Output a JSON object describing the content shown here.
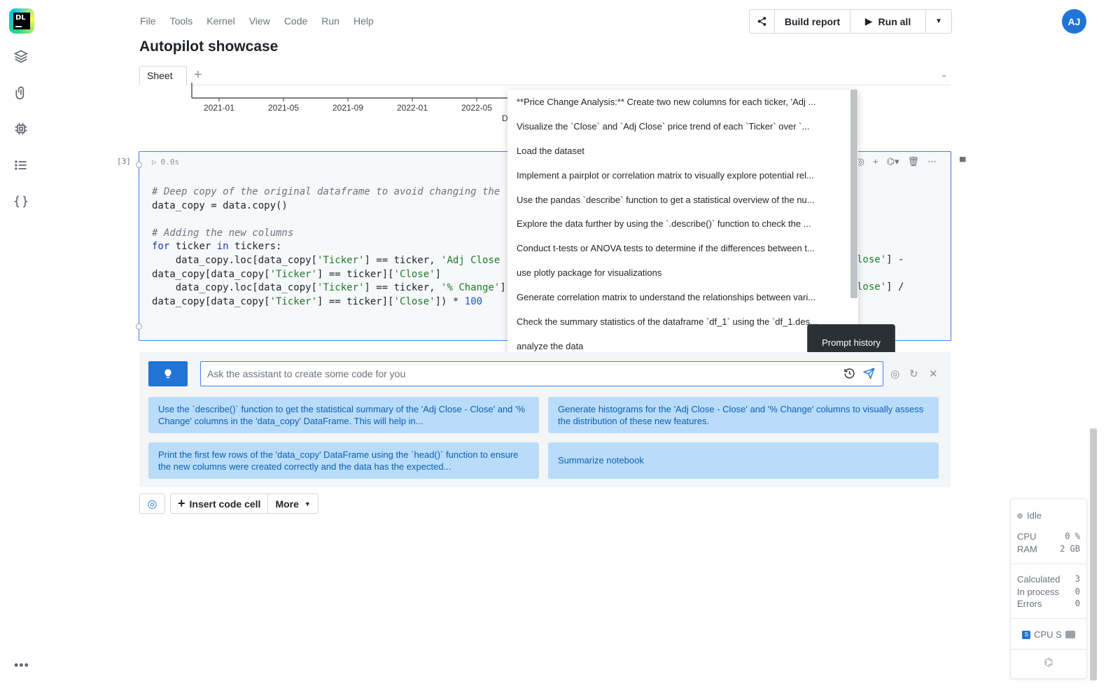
{
  "app": {
    "logo_text": "DL",
    "title": "Autopilot showcase",
    "avatar": "AJ"
  },
  "menu": [
    "File",
    "Tools",
    "Kernel",
    "View",
    "Code",
    "Run",
    "Help"
  ],
  "toolbar": {
    "build_label": "Build report",
    "run_label": "Run all"
  },
  "tabs": {
    "sheet": "Sheet"
  },
  "chart": {
    "ticks": [
      "2021-01",
      "2021-05",
      "2021-09",
      "2022-01",
      "2022-05"
    ],
    "partial_label": "D"
  },
  "cell": {
    "index": "[3]",
    "time": "0.0s",
    "comment1": "# Deep copy of the original dataframe to avoid changing the",
    "line1": "data_copy = data.copy()",
    "comment2": "# Adding the new columns",
    "for_kw": "for",
    "for_var": " ticker ",
    "in_kw": "in",
    "for_rest": " tickers:",
    "l3a": "    data_copy.loc[data_copy[",
    "l3s1": "'Ticker'",
    "l3b": "] == ticker, ",
    "l3s2": "'Adj Close",
    "l4a": "data_copy[data_copy[",
    "l4s1": "'Ticker'",
    "l4b": "] == ticker][",
    "l4s2": "'Close'",
    "l4c": "]",
    "l5a": "    data_copy.loc[data_copy[",
    "l5s1": "'Ticker'",
    "l5b": "] == ticker, ",
    "l5s2": "'% Change'",
    "l5c": "]",
    "l6a": "data_copy[data_copy[",
    "l6s1": "'Ticker'",
    "l6b": "] == ticker][",
    "l6s2": "'Close'",
    "l6c": "]) * ",
    "l6n": "100",
    "r1s": "lose'",
    "r1c": "] -",
    "r2s": "lose'",
    "r2c": "] /"
  },
  "prompt_history": [
    "**Price Change Analysis:** Create two new columns for each ticker, 'Adj ...",
    "Visualize the `Close` and `Adj Close` price trend of each `Ticker` over `...",
    "Load the dataset",
    "Implement a pairplot or correlation matrix to visually explore potential rel...",
    "Use the pandas `describe` function to get a statistical overview of the nu...",
    "Explore the data further by using the `.describe()` function to check the ...",
    "Conduct t-tests or ANOVA tests to determine if the differences between t...",
    "use plotly package for visualizations",
    "Generate correlation matrix to understand the relationships between vari...",
    "Check the summary statistics of the dataframe `df_1` using the `df_1.des...",
    "analyze the data"
  ],
  "tooltip": "Prompt history",
  "assistant": {
    "placeholder": "Ask the assistant to create some code for you",
    "suggestions": [
      "Use the `describe()` function to get the statistical summary of the 'Adj Close - Close' and '% Change' columns in the 'data_copy' DataFrame. This will help in...",
      "Generate histograms for the 'Adj Close - Close' and '% Change' columns to visually assess the distribution of these new features.",
      "Print the first few rows of the 'data_copy' DataFrame using the `head()` function to ensure the new columns were created correctly and the data has the expected...",
      "Summarize notebook"
    ]
  },
  "bottom": {
    "insert_label": "Insert code cell",
    "more_label": "More"
  },
  "status": {
    "state": "Idle",
    "cpu_label": "CPU",
    "cpu_value": "0 %",
    "ram_label": "RAM",
    "ram_value": "2 GB",
    "calculated_label": "Calculated",
    "calculated_value": "3",
    "inprocess_label": "In process",
    "inprocess_value": "0",
    "errors_label": "Errors",
    "errors_value": "0",
    "machine_label": "CPU S"
  }
}
